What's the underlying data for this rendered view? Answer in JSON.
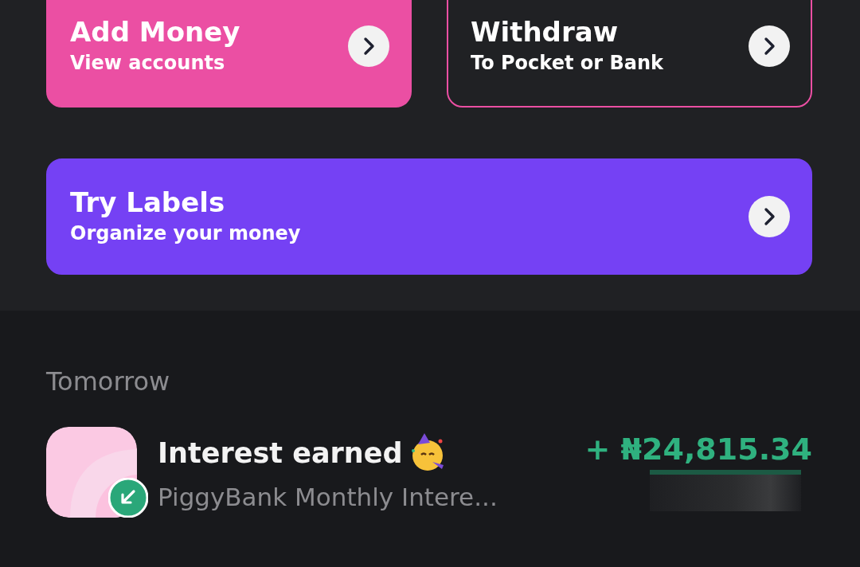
{
  "actions": [
    {
      "kind": "filled",
      "title": "Add Money",
      "subtitle": "View accounts",
      "color": "#eb4fa3"
    },
    {
      "kind": "outlined",
      "title": "Withdraw",
      "subtitle": "To Pocket or Bank",
      "color": "#eb4fa3"
    }
  ],
  "promo": {
    "kind": "filled",
    "title": "Try Labels",
    "subtitle": "Organize your money",
    "color": "#7541f4"
  },
  "transactions": {
    "heading": "Tomorrow",
    "items": [
      {
        "title": "Interest earned",
        "subtitle": "PiggyBank Monthly Intere...",
        "amount": "+ ₦24,815.34",
        "kind": "incoming"
      }
    ]
  }
}
